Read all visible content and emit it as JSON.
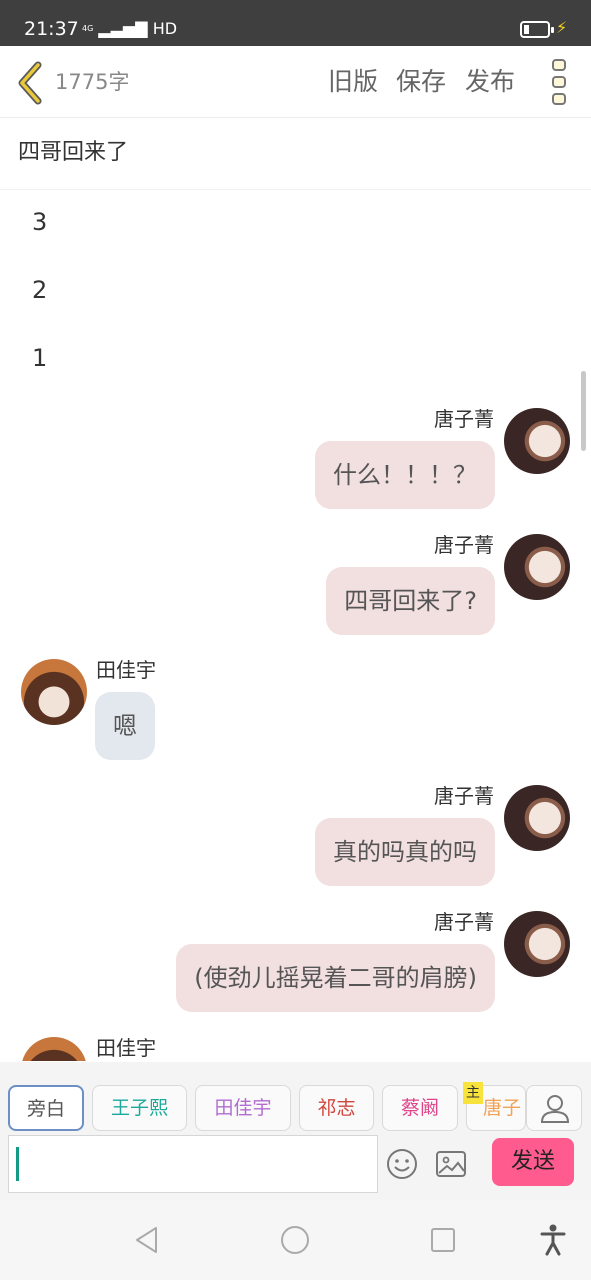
{
  "status_bar": {
    "time": "21:37",
    "network": "4G",
    "signal_label": "HD"
  },
  "header": {
    "word_count": "1775字",
    "old_version_label": "旧版",
    "save_label": "保存",
    "publish_label": "发布"
  },
  "chapter_title": "四哥回来了",
  "narration": [
    "3",
    "2",
    "1"
  ],
  "messages": [
    {
      "speaker": "唐子菁",
      "side": "right",
      "text": "什么！！！？"
    },
    {
      "speaker": "唐子菁",
      "side": "right",
      "text": "四哥回来了?"
    },
    {
      "speaker": "田佳宇",
      "side": "left",
      "text": "嗯"
    },
    {
      "speaker": "唐子菁",
      "side": "right",
      "text": "真的吗真的吗"
    },
    {
      "speaker": "唐子菁",
      "side": "right",
      "text": "(使劲儿摇晃着二哥的肩膀)"
    },
    {
      "speaker": "田佳宇",
      "side": "left",
      "text": ""
    }
  ],
  "characters": [
    {
      "name": "旁白",
      "color": "#555555",
      "selected": true
    },
    {
      "name": "王子熙",
      "color": "#1aa99a"
    },
    {
      "name": "田佳宇",
      "color": "#b26cd0"
    },
    {
      "name": "祁志",
      "color": "#d2443c"
    },
    {
      "name": "蔡阚",
      "color": "#e0448a"
    },
    {
      "name": "唐子",
      "color": "#f2a255",
      "badge": "主"
    }
  ],
  "composer": {
    "input_value": "",
    "send_label": "发送"
  },
  "colors": {
    "send": "#ff5b8f",
    "right_bubble": "#f2dfe0",
    "left_bubble": "#e3e8ee",
    "back_accent": "#e9c93a"
  }
}
